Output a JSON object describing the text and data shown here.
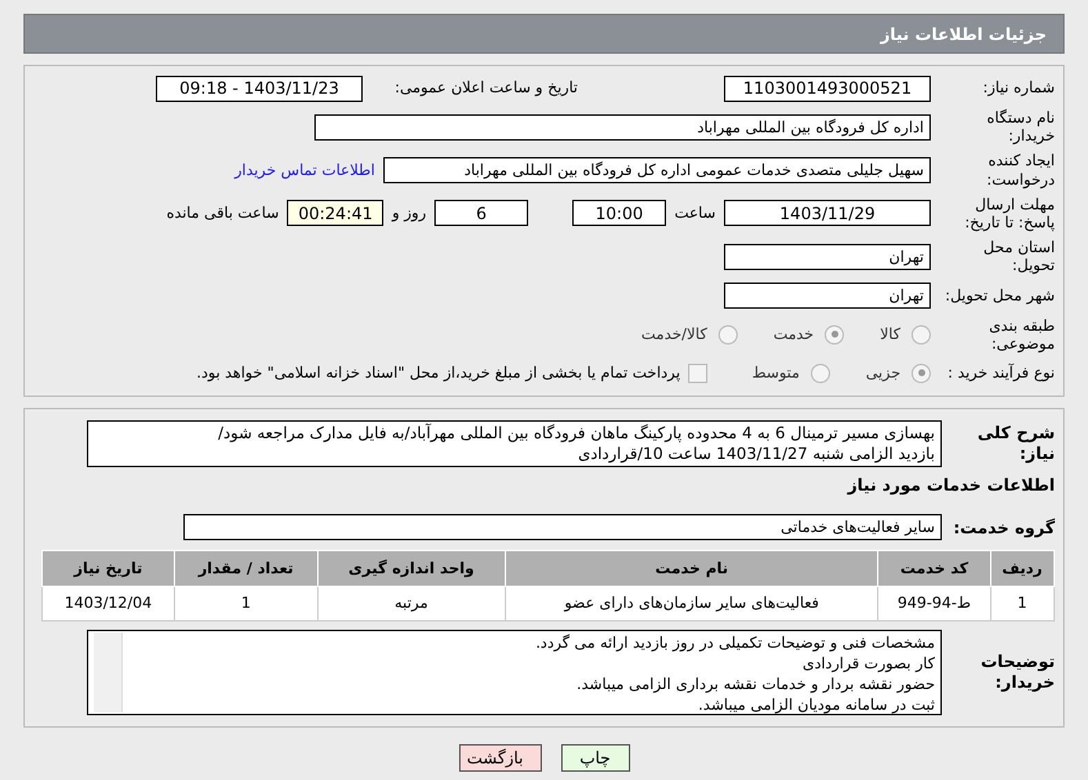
{
  "header": {
    "title": "جزئیات اطلاعات نیاز"
  },
  "need": {
    "number": {
      "label": "شماره نیاز:",
      "value": "1103001493000521"
    },
    "announce": {
      "label": "تاریخ و ساعت اعلان عمومی:",
      "value": "1403/11/23 - 09:18"
    },
    "buyer": {
      "label": "نام دستگاه خریدار:",
      "value": "اداره کل فرودگاه بین المللی مهراباد"
    },
    "requester": {
      "label": "ایجاد کننده درخواست:",
      "value": "سهیل جلیلی متصدی خدمات عمومی اداره کل فرودگاه بین المللی مهراباد",
      "link": "اطلاعات تماس خریدار"
    },
    "deadline": {
      "label": "مهلت ارسال پاسخ: تا تاریخ:",
      "date": "1403/11/29",
      "time_label": "ساعت",
      "time": "10:00",
      "days": "6",
      "days_label": "روز و",
      "remaining": "00:24:41",
      "remaining_label": "ساعت باقی مانده"
    },
    "province": {
      "label": "استان محل تحویل:",
      "value": "تهران"
    },
    "city": {
      "label": "شهر محل تحویل:",
      "value": "تهران"
    },
    "category": {
      "label": "طبقه بندی موضوعی:",
      "options": [
        {
          "label": "کالا",
          "selected": false
        },
        {
          "label": "خدمت",
          "selected": true
        },
        {
          "label": "کالا/خدمت",
          "selected": false
        }
      ]
    },
    "process": {
      "label": "نوع فرآیند خرید :",
      "options": [
        {
          "label": "جزیی",
          "selected": true
        },
        {
          "label": "متوسط",
          "selected": false
        }
      ],
      "payment": {
        "checked": false,
        "text": "پرداخت تمام یا بخشی از مبلغ خرید،از محل \"اسناد خزانه اسلامی\" خواهد بود."
      }
    }
  },
  "description": {
    "label": "شرح کلی نیاز:",
    "lines": [
      "بهسازی مسیر ترمینال 6 به 4 محدوده پارکینگ ماهان فرودگاه بین المللی مهرآباد/به فایل مدارک مراجعه شود/",
      "بازدید الزامی شنبه 1403/11/27 ساعت 10/قراردادی"
    ]
  },
  "services": {
    "title": "اطلاعات خدمات مورد نیاز",
    "group": {
      "label": "گروه خدمت:",
      "value": "سایر فعالیت‌های خدماتی"
    },
    "table": {
      "columns": [
        "ردیف",
        "کد خدمت",
        "نام خدمت",
        "واحد اندازه گیری",
        "تعداد / مقدار",
        "تاریخ نیاز"
      ],
      "rows": [
        [
          "1",
          "ط-94-949",
          "فعالیت‌های سایر سازمان‌های دارای عضو",
          "مرتبه",
          "1",
          "1403/12/04"
        ]
      ]
    },
    "notes": {
      "label": "توضیحات خریدار:",
      "lines": [
        "مشخصات فنی و توضیحات تکمیلی در روز بازدید ارائه می گردد.",
        "کار بصورت قراردادی",
        "حضور نقشه بردار و خدمات نقشه برداری الزامی میباشد.",
        "ثبت در سامانه مودیان الزامی میباشد."
      ]
    }
  },
  "buttons": [
    {
      "kind": "print",
      "label": "چاپ"
    },
    {
      "kind": "back",
      "label": "بازگشت"
    }
  ]
}
